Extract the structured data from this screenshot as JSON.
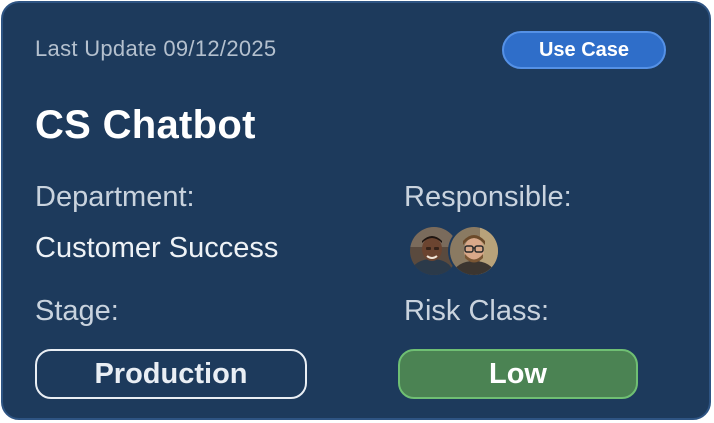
{
  "card": {
    "last_update": "Last Update 09/12/2025",
    "badge_label": "Use Case",
    "title": "CS Chatbot",
    "department_label": "Department:",
    "department_value": "Customer Success",
    "responsible_label": "Responsible:",
    "responsible_avatars": [
      "avatar-person-1",
      "avatar-person-2"
    ],
    "stage_label": "Stage:",
    "stage_value": "Production",
    "risk_label": "Risk Class:",
    "risk_value": "Low"
  },
  "colors": {
    "card_background": "#1d3a5c",
    "badge_background": "#2f6ec9",
    "risk_low_background": "#4b8353",
    "risk_low_border": "#6fbf73"
  }
}
